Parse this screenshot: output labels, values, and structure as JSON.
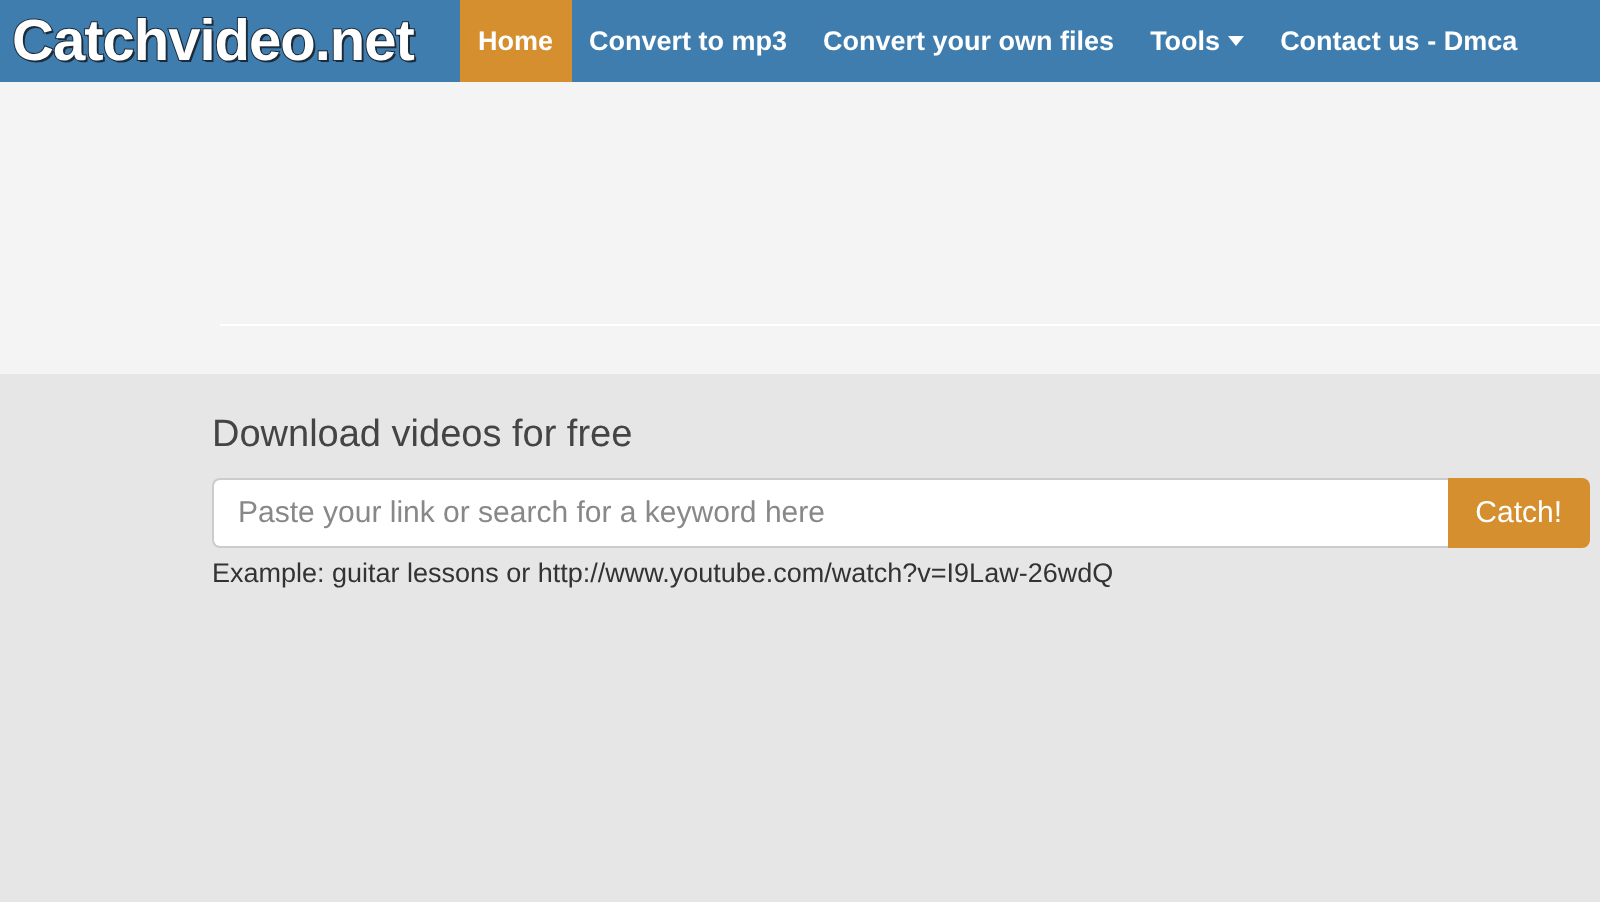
{
  "logo": "Catchvideo.net",
  "nav": [
    {
      "label": "Home",
      "selected": true,
      "dropdown": false
    },
    {
      "label": "Convert to mp3",
      "selected": false,
      "dropdown": false
    },
    {
      "label": "Convert your own files",
      "selected": false,
      "dropdown": false
    },
    {
      "label": "Tools",
      "selected": false,
      "dropdown": true
    },
    {
      "label": "Contact us - Dmca",
      "selected": false,
      "dropdown": false
    }
  ],
  "heading": "Download videos for free",
  "search": {
    "placeholder": "Paste your link or search for a keyword here",
    "button": "Catch!"
  },
  "example": "Example: guitar lessons or http://www.youtube.com/watch?v=I9Law-26wdQ"
}
